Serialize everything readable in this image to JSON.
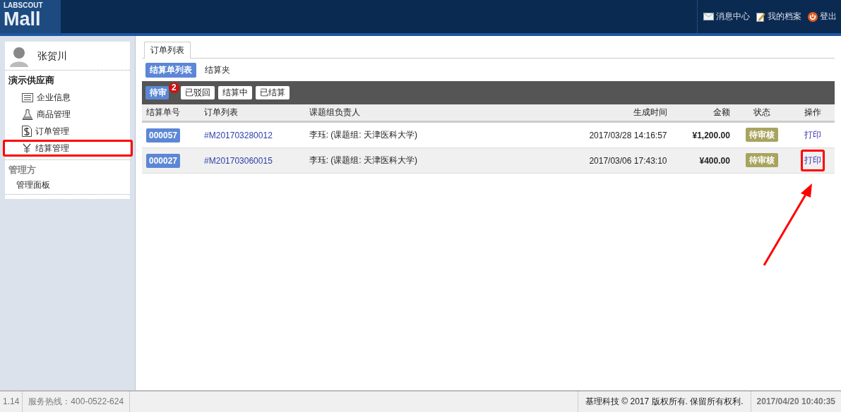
{
  "header": {
    "logo_top": "LABSCOUT",
    "logo_main": "Mall",
    "links": [
      {
        "kind": "mail",
        "label": "消息中心"
      },
      {
        "kind": "edit",
        "label": "我的档案"
      },
      {
        "kind": "power",
        "label": "登出"
      }
    ]
  },
  "sidebar": {
    "user": "张贺川",
    "sections": [
      {
        "title": "演示供应商",
        "muted": false,
        "items": [
          {
            "kind": "list",
            "label": "企业信息",
            "highlighted": false
          },
          {
            "kind": "flask",
            "label": "商品管理",
            "highlighted": false
          },
          {
            "kind": "doc",
            "label": "订单管理",
            "highlighted": false
          },
          {
            "kind": "yen",
            "label": "结算管理",
            "highlighted": true
          }
        ]
      },
      {
        "title": "管理方",
        "muted": true,
        "items": [
          {
            "kind": "plain",
            "label": "管理面板",
            "highlighted": false
          }
        ]
      }
    ]
  },
  "tabs": [
    {
      "label": "订单列表",
      "selected": true
    }
  ],
  "subtabs": [
    {
      "label": "结算单列表",
      "selected": true
    },
    {
      "label": "结算夹",
      "selected": false
    }
  ],
  "filters": [
    {
      "label": "待审",
      "selected": true,
      "badge": "2"
    },
    {
      "label": "已驳回",
      "selected": false
    },
    {
      "label": "结算中",
      "selected": false
    },
    {
      "label": "已结算",
      "selected": false
    }
  ],
  "table": {
    "columns": [
      "结算单号",
      "订单列表",
      "课题组负责人",
      "生成时间",
      "金额",
      "状态",
      "操作"
    ],
    "rows": [
      {
        "id": "000057",
        "order": "#M201703280012",
        "owner": "李珏: (课题组: 天津医科大学)",
        "time": "2017/03/28 14:16:57",
        "amount": "¥1,200.00",
        "status": "待审核",
        "action": "打印",
        "highlighted": false
      },
      {
        "id": "000027",
        "order": "#M201703060015",
        "owner": "李珏: (课题组: 天津医科大学)",
        "time": "2017/03/06 17:43:10",
        "amount": "¥400.00",
        "status": "待审核",
        "action": "打印",
        "highlighted": true
      }
    ]
  },
  "status_bar": {
    "version": "1.14",
    "hotline": "服务热线：400-0522-624",
    "copyright": "基理科技 © 2017 版权所有. 保留所有权利.",
    "datetime": "2017/04/20 10:40:35"
  }
}
